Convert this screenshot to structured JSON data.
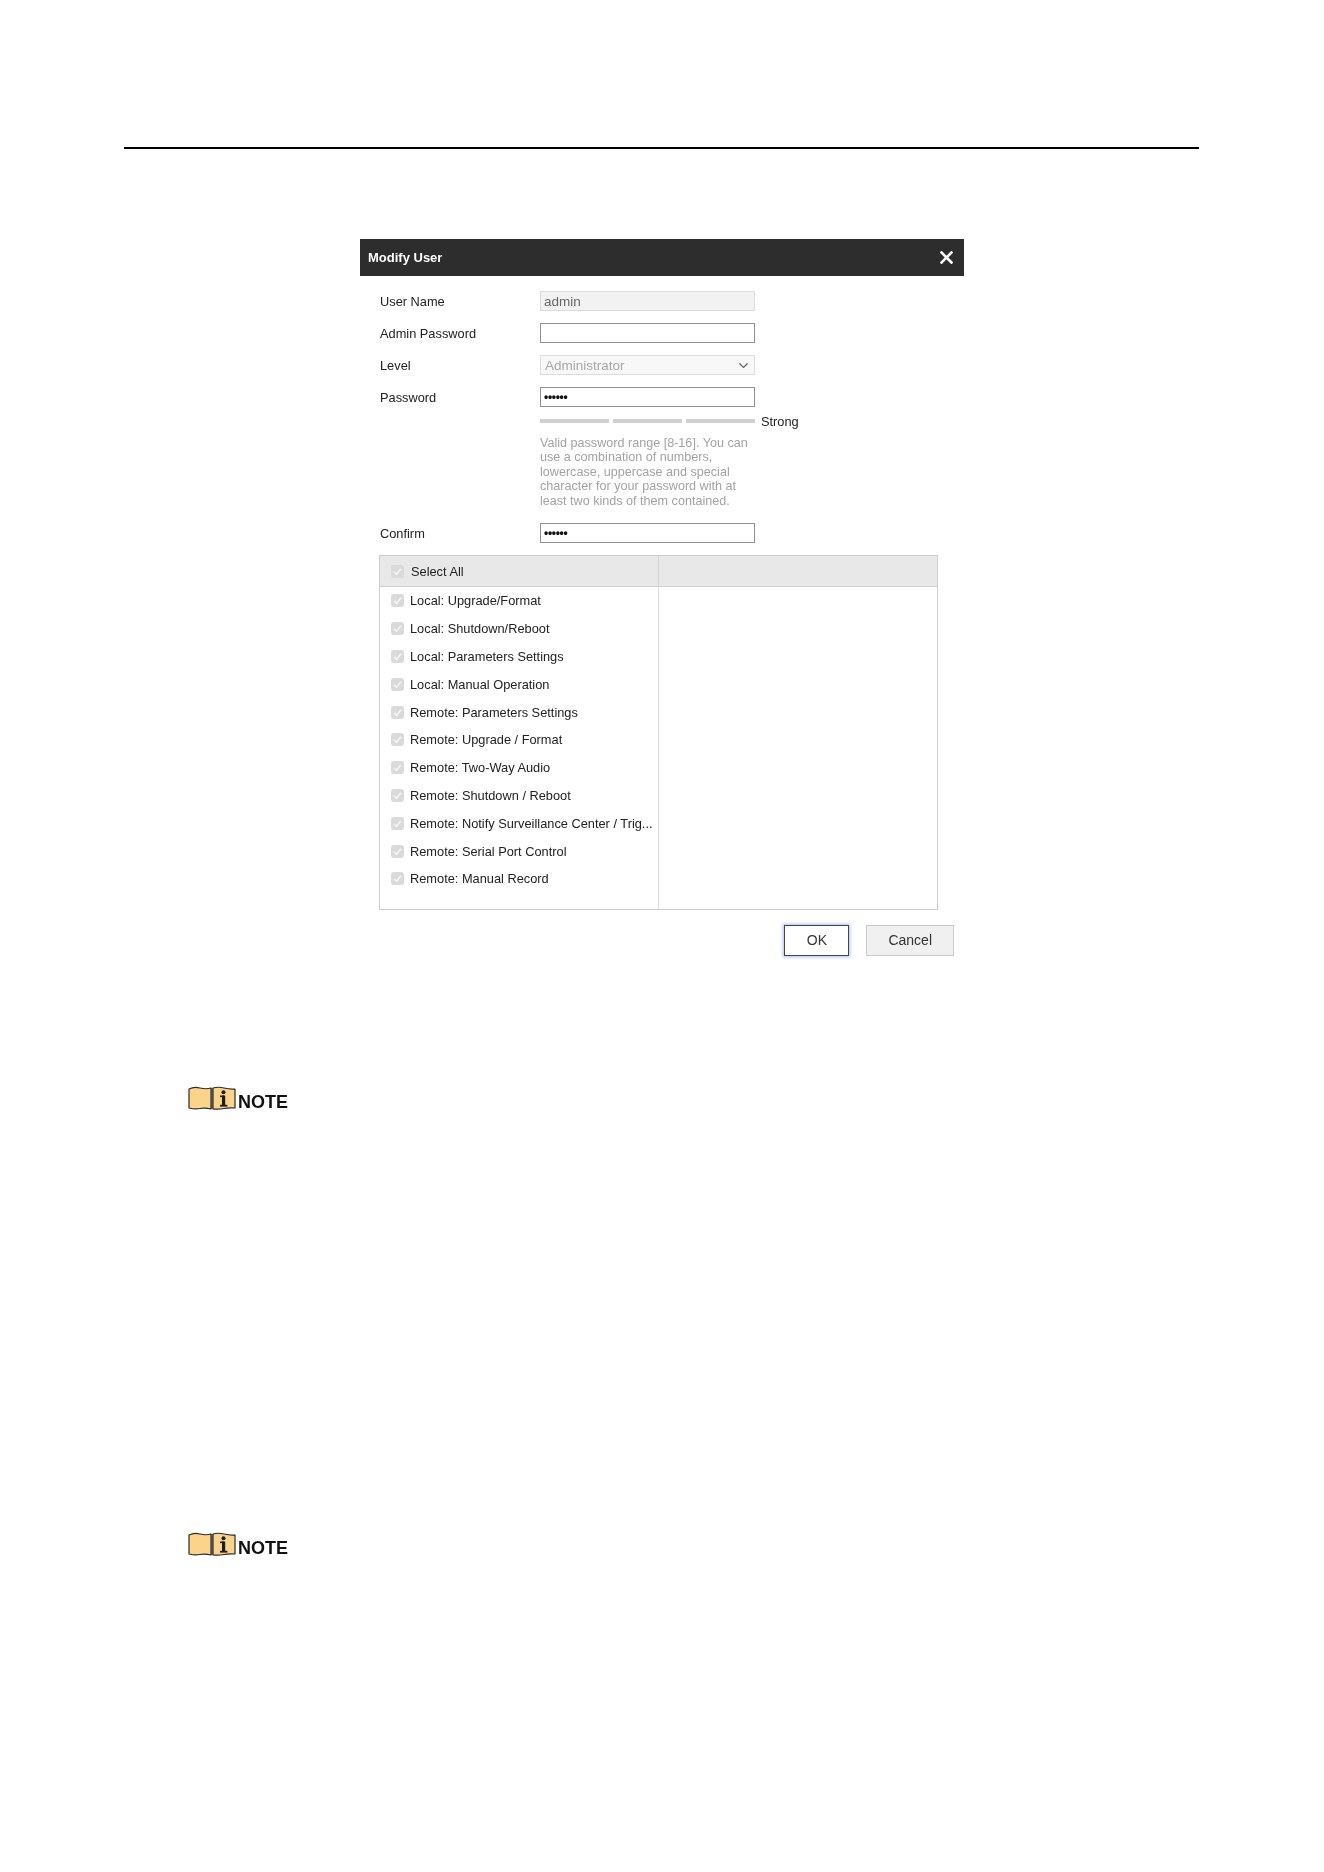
{
  "dialog": {
    "title": "Modify User"
  },
  "form": {
    "fields": [
      {
        "kind": "text",
        "label": "User Name",
        "value": "admin",
        "disabled": true
      },
      {
        "kind": "password",
        "label": "Admin Password",
        "disabled": false
      },
      {
        "kind": "select",
        "label": "Level",
        "value": "Administrator",
        "disabled": true
      },
      {
        "kind": "password",
        "label": "Password",
        "value": "••••••",
        "disabled": false,
        "strength": {
          "label": "Strong"
        },
        "hint": "Valid password range [8-16]. You can use a combination of numbers, lowercase, uppercase and special character for your password with at least two kinds of them contained."
      },
      {
        "kind": "password",
        "label": "Confirm",
        "value": "••••••",
        "disabled": false
      }
    ]
  },
  "permissions": {
    "select_all": {
      "label": "Select All",
      "checked": true,
      "disabled": true
    },
    "items": [
      {
        "label": "Local: Upgrade/Format",
        "checked": true,
        "disabled": true
      },
      {
        "label": "Local: Shutdown/Reboot",
        "checked": true,
        "disabled": true
      },
      {
        "label": "Local: Parameters Settings",
        "checked": true,
        "disabled": true
      },
      {
        "label": "Local: Manual Operation",
        "checked": true,
        "disabled": true
      },
      {
        "label": "Remote: Parameters Settings",
        "checked": true,
        "disabled": true
      },
      {
        "label": "Remote: Upgrade / Format",
        "checked": true,
        "disabled": true
      },
      {
        "label": "Remote: Two-Way Audio",
        "checked": true,
        "disabled": true
      },
      {
        "label": "Remote: Shutdown / Reboot",
        "checked": true,
        "disabled": true
      },
      {
        "label": "Remote: Notify Surveillance Center / Trig...",
        "checked": true,
        "disabled": true
      },
      {
        "label": "Remote: Serial Port Control",
        "checked": true,
        "disabled": true
      },
      {
        "label": "Remote: Manual Record",
        "checked": true,
        "disabled": true
      }
    ]
  },
  "buttons": [
    {
      "label": "OK",
      "focused": true
    },
    {
      "label": "Cancel",
      "focused": false
    }
  ],
  "notes": [
    {
      "label": "NOTE"
    },
    {
      "label": "NOTE"
    }
  ]
}
